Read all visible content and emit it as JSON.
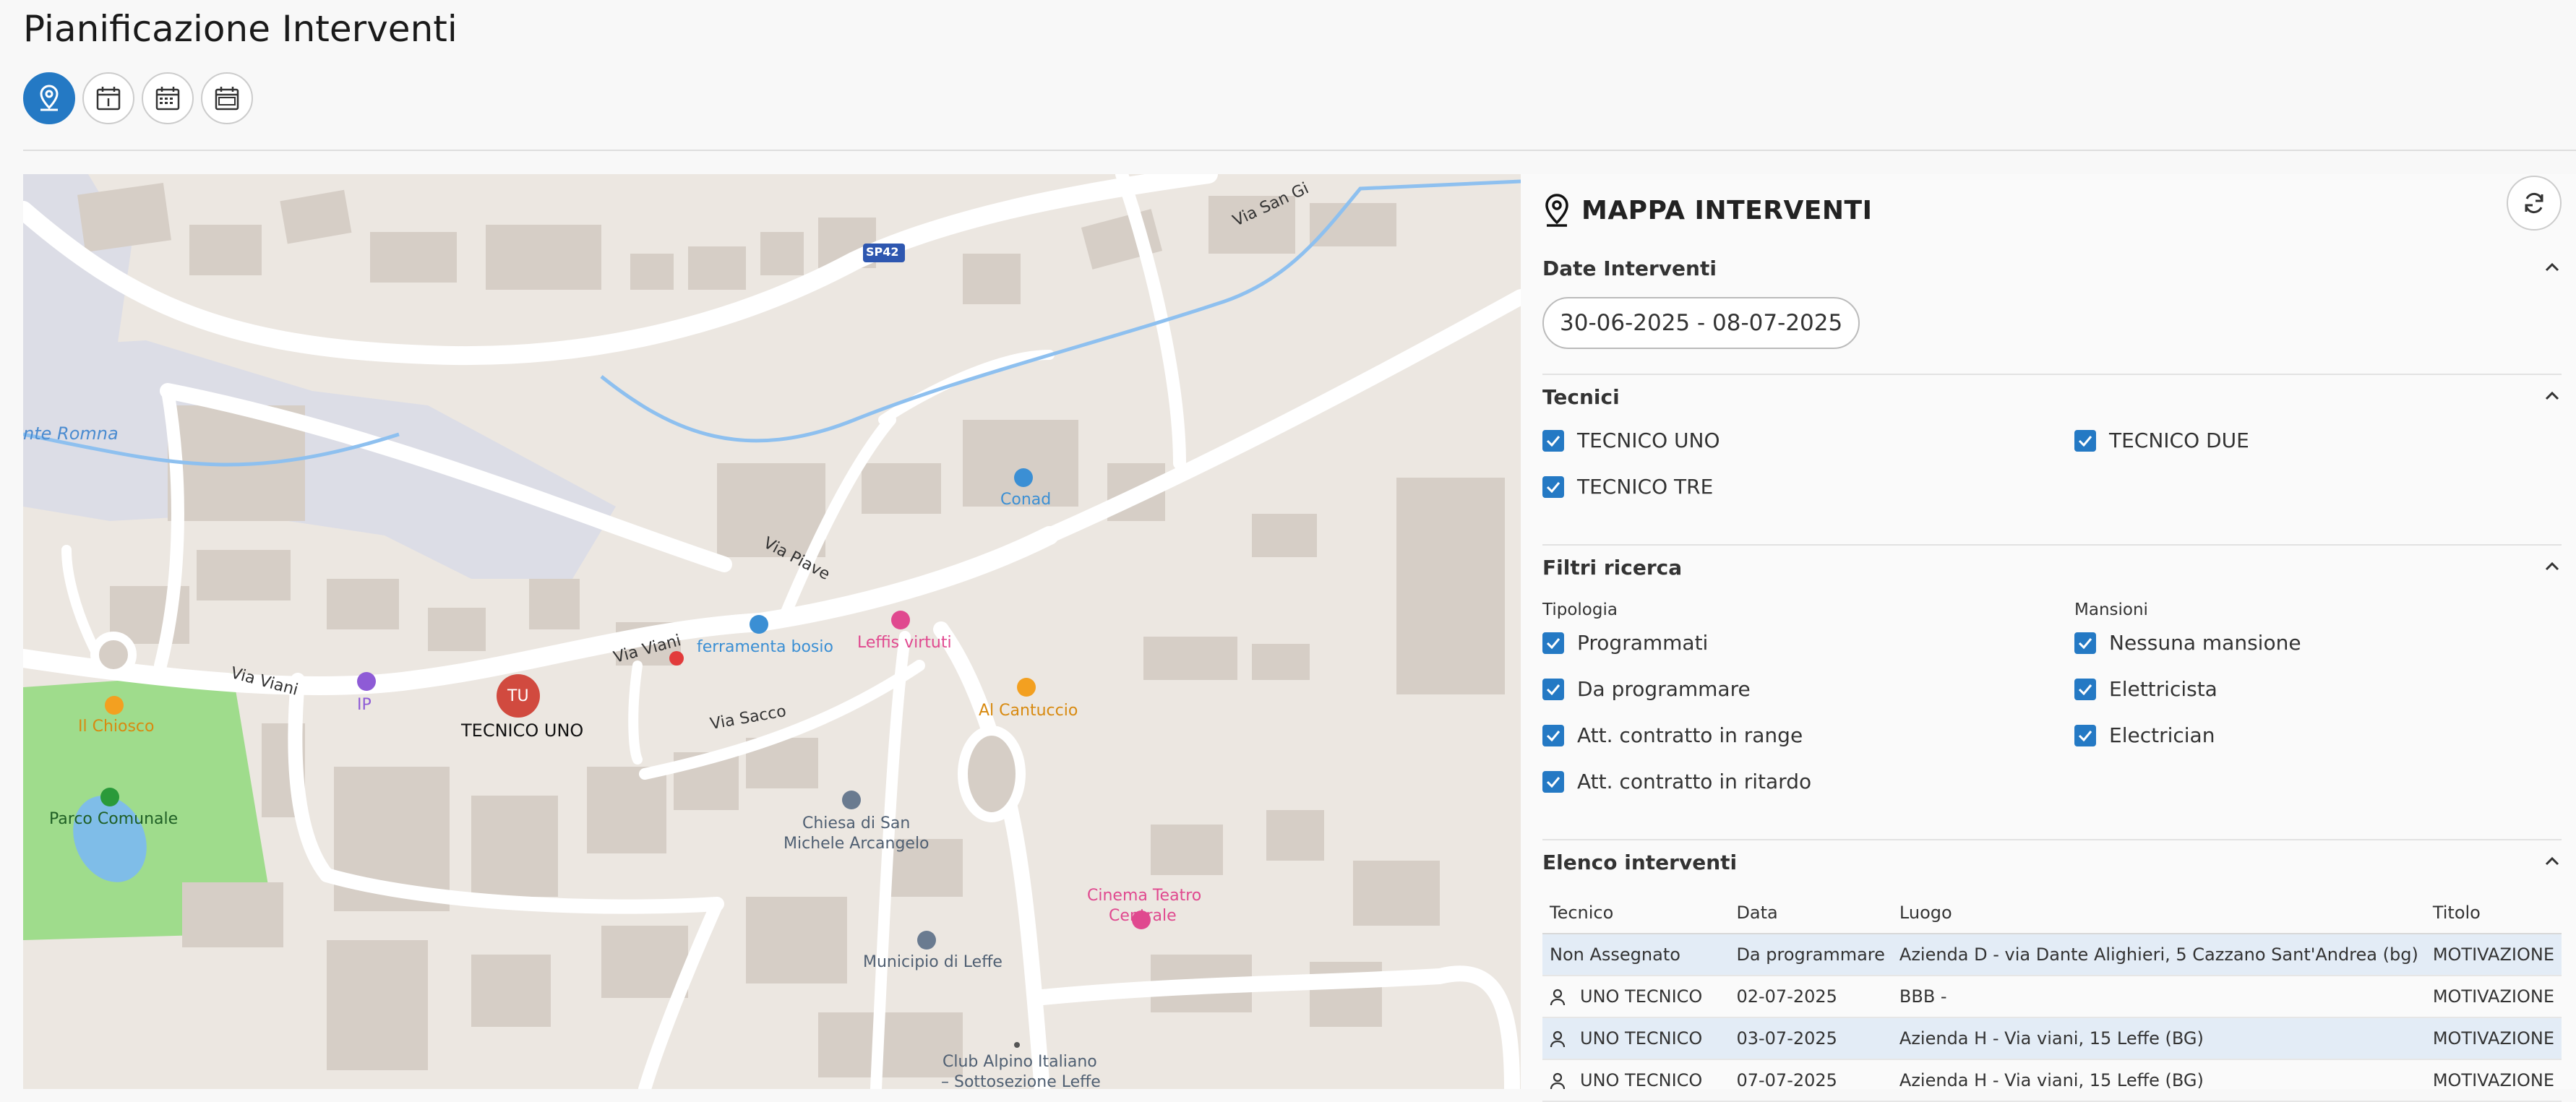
{
  "page": {
    "title": "Pianificazione Interventi"
  },
  "view_buttons": [
    {
      "icon": "map-pin-icon",
      "active": true
    },
    {
      "icon": "calendar-day-icon",
      "active": false
    },
    {
      "icon": "calendar-month-icon",
      "active": false
    },
    {
      "icon": "calendar-year-icon",
      "active": false
    }
  ],
  "map": {
    "street_labels": [
      "SP42",
      "Via San Gi",
      "nte Romna",
      "Via Piave",
      "Via Viani",
      "Via Viani",
      "Via Sacco"
    ],
    "pois": {
      "conad": "Conad",
      "ferramenta": "ferramenta bosio",
      "leffis": "Leffis virtuti",
      "al_cantuccio": "Al Cantuccio",
      "il_chiosco": "Il Chiosco",
      "ip": "IP",
      "parco": "Parco Comunale",
      "chiesa_1": "Chiesa di San",
      "chiesa_2": "Michele Arcangelo",
      "cinema_1": "Cinema Teatro",
      "cinema_2": "Centrale",
      "municipio": "Municipio di Leffe",
      "club_1": "Club Alpino Italiano",
      "club_2": "– Sottosezione Leffe"
    },
    "technician_marker": {
      "initials": "TU",
      "label": "TECNICO UNO",
      "color": "#d14a3f"
    }
  },
  "panel": {
    "title": "MAPPA INTERVENTI",
    "dates": {
      "title": "Date Interventi",
      "range": "30-06-2025 - 08-07-2025"
    },
    "tecnici": {
      "title": "Tecnici",
      "items": [
        "TECNICO UNO",
        "TECNICO DUE",
        "TECNICO TRE"
      ]
    },
    "filtri": {
      "title": "Filtri ricerca",
      "tipologia_label": "Tipologia",
      "tipologia": [
        "Programmati",
        "Da programmare",
        "Att. contratto in range",
        "Att. contratto in ritardo"
      ],
      "mansioni_label": "Mansioni",
      "mansioni": [
        "Nessuna mansione",
        "Elettricista",
        "Electrician"
      ]
    },
    "elenco": {
      "title": "Elenco interventi",
      "columns": [
        "Tecnico",
        "Data",
        "Luogo",
        "Titolo"
      ],
      "rows": [
        {
          "tecnico": "Non Assegnato",
          "data": "Da programmare",
          "luogo": "Azienda D - via Dante Alighieri, 5 Cazzano Sant'Andrea (bg)",
          "titolo": "MOTIVAZIONE"
        },
        {
          "tecnico": "UNO TECNICO",
          "data": "02-07-2025",
          "luogo": "BBB -",
          "titolo": "MOTIVAZIONE"
        },
        {
          "tecnico": "UNO TECNICO",
          "data": "03-07-2025",
          "luogo": "Azienda H - Via viani, 15 Leffe (BG)",
          "titolo": "MOTIVAZIONE"
        },
        {
          "tecnico": "UNO TECNICO",
          "data": "07-07-2025",
          "luogo": "Azienda H - Via viani, 15 Leffe (BG)",
          "titolo": "MOTIVAZIONE"
        }
      ]
    }
  },
  "colors": {
    "accent": "#2479c4",
    "marker": "#d14a3f",
    "highlight_row": "#e3ecf6"
  }
}
